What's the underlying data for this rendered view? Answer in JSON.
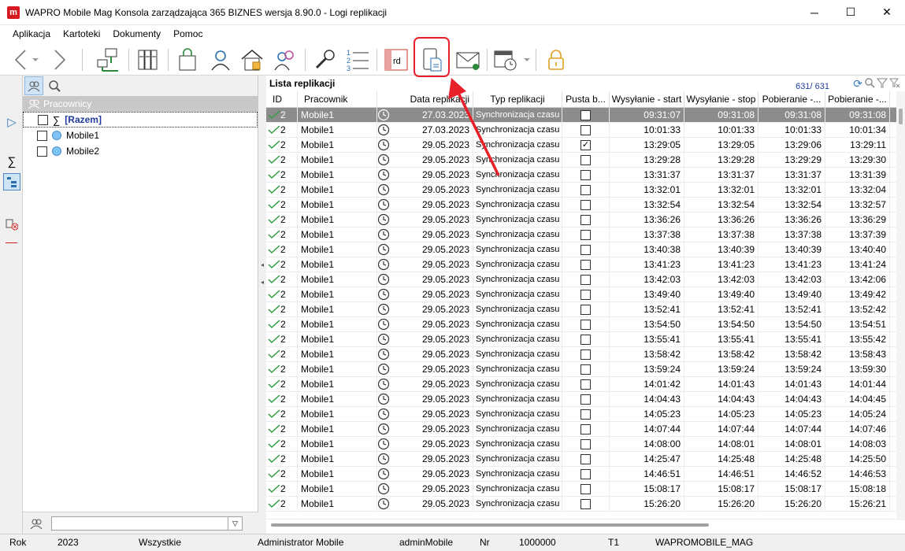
{
  "window": {
    "title": "WAPRO Mobile Mag Konsola zarządzająca 365 BIZNES wersja 8.90.0 - Logi replikacji",
    "logo_letter": "m",
    "minimize": "─",
    "maximize": "☐",
    "close": "✕"
  },
  "menu": [
    "Aplikacja",
    "Kartoteki",
    "Dokumenty",
    "Pomoc"
  ],
  "toolbar": {
    "rd_label": "rd",
    "icons": [
      "back-arrow-icon",
      "forward-arrow-icon",
      "network-icon",
      "binders-icon",
      "shopping-bag-icon",
      "user-icon",
      "home-icon",
      "users-icon",
      "wrench-icon",
      "numbered-list-icon",
      "rd-report-icon",
      "mobile-document-icon",
      "envelope-icon",
      "calendar-clock-icon",
      "lock-icon"
    ]
  },
  "left_panel": {
    "header": "Pracownicy",
    "items": [
      {
        "label": "[Razem]",
        "type": "sum"
      },
      {
        "label": "Mobile1",
        "type": "user"
      },
      {
        "label": "Mobile2",
        "type": "user"
      }
    ],
    "filter_value": ""
  },
  "list": {
    "title": "Lista replikacji",
    "counter": "631/ 631",
    "columns": [
      "ID",
      "Pracownik",
      "Data replikacji",
      "Typ replikacji",
      "Pusta b...",
      "Wysyłanie - start",
      "Wysyłanie - stop",
      "Pobieranie -...",
      "Pobieranie -..."
    ],
    "rows": [
      {
        "id": "2",
        "p": "Mobile1",
        "d": "27.03.2023",
        "t": "Synchronizacja czasu",
        "b": false,
        "ws": "09:31:07",
        "we": "09:31:08",
        "ps": "09:31:08",
        "pe": "09:31:08"
      },
      {
        "id": "2",
        "p": "Mobile1",
        "d": "27.03.2023",
        "t": "Synchronizacja czasu",
        "b": false,
        "ws": "10:01:33",
        "we": "10:01:33",
        "ps": "10:01:33",
        "pe": "10:01:34"
      },
      {
        "id": "2",
        "p": "Mobile1",
        "d": "29.05.2023",
        "t": "Synchronizacja czasu",
        "b": true,
        "ws": "13:29:05",
        "we": "13:29:05",
        "ps": "13:29:06",
        "pe": "13:29:11"
      },
      {
        "id": "2",
        "p": "Mobile1",
        "d": "29.05.2023",
        "t": "Synchronizacja czasu",
        "b": false,
        "ws": "13:29:28",
        "we": "13:29:28",
        "ps": "13:29:29",
        "pe": "13:29:30"
      },
      {
        "id": "2",
        "p": "Mobile1",
        "d": "29.05.2023",
        "t": "Synchronizacja czasu",
        "b": false,
        "ws": "13:31:37",
        "we": "13:31:37",
        "ps": "13:31:37",
        "pe": "13:31:39"
      },
      {
        "id": "2",
        "p": "Mobile1",
        "d": "29.05.2023",
        "t": "Synchronizacja czasu",
        "b": false,
        "ws": "13:32:01",
        "we": "13:32:01",
        "ps": "13:32:01",
        "pe": "13:32:04"
      },
      {
        "id": "2",
        "p": "Mobile1",
        "d": "29.05.2023",
        "t": "Synchronizacja czasu",
        "b": false,
        "ws": "13:32:54",
        "we": "13:32:54",
        "ps": "13:32:54",
        "pe": "13:32:57"
      },
      {
        "id": "2",
        "p": "Mobile1",
        "d": "29.05.2023",
        "t": "Synchronizacja czasu",
        "b": false,
        "ws": "13:36:26",
        "we": "13:36:26",
        "ps": "13:36:26",
        "pe": "13:36:29"
      },
      {
        "id": "2",
        "p": "Mobile1",
        "d": "29.05.2023",
        "t": "Synchronizacja czasu",
        "b": false,
        "ws": "13:37:38",
        "we": "13:37:38",
        "ps": "13:37:38",
        "pe": "13:37:39"
      },
      {
        "id": "2",
        "p": "Mobile1",
        "d": "29.05.2023",
        "t": "Synchronizacja czasu",
        "b": false,
        "ws": "13:40:38",
        "we": "13:40:39",
        "ps": "13:40:39",
        "pe": "13:40:40"
      },
      {
        "id": "2",
        "p": "Mobile1",
        "d": "29.05.2023",
        "t": "Synchronizacja czasu",
        "b": false,
        "ws": "13:41:23",
        "we": "13:41:23",
        "ps": "13:41:23",
        "pe": "13:41:24"
      },
      {
        "id": "2",
        "p": "Mobile1",
        "d": "29.05.2023",
        "t": "Synchronizacja czasu",
        "b": false,
        "ws": "13:42:03",
        "we": "13:42:03",
        "ps": "13:42:03",
        "pe": "13:42:06"
      },
      {
        "id": "2",
        "p": "Mobile1",
        "d": "29.05.2023",
        "t": "Synchronizacja czasu",
        "b": false,
        "ws": "13:49:40",
        "we": "13:49:40",
        "ps": "13:49:40",
        "pe": "13:49:42"
      },
      {
        "id": "2",
        "p": "Mobile1",
        "d": "29.05.2023",
        "t": "Synchronizacja czasu",
        "b": false,
        "ws": "13:52:41",
        "we": "13:52:41",
        "ps": "13:52:41",
        "pe": "13:52:42"
      },
      {
        "id": "2",
        "p": "Mobile1",
        "d": "29.05.2023",
        "t": "Synchronizacja czasu",
        "b": false,
        "ws": "13:54:50",
        "we": "13:54:50",
        "ps": "13:54:50",
        "pe": "13:54:51"
      },
      {
        "id": "2",
        "p": "Mobile1",
        "d": "29.05.2023",
        "t": "Synchronizacja czasu",
        "b": false,
        "ws": "13:55:41",
        "we": "13:55:41",
        "ps": "13:55:41",
        "pe": "13:55:42"
      },
      {
        "id": "2",
        "p": "Mobile1",
        "d": "29.05.2023",
        "t": "Synchronizacja czasu",
        "b": false,
        "ws": "13:58:42",
        "we": "13:58:42",
        "ps": "13:58:42",
        "pe": "13:58:43"
      },
      {
        "id": "2",
        "p": "Mobile1",
        "d": "29.05.2023",
        "t": "Synchronizacja czasu",
        "b": false,
        "ws": "13:59:24",
        "we": "13:59:24",
        "ps": "13:59:24",
        "pe": "13:59:30"
      },
      {
        "id": "2",
        "p": "Mobile1",
        "d": "29.05.2023",
        "t": "Synchronizacja czasu",
        "b": false,
        "ws": "14:01:42",
        "we": "14:01:43",
        "ps": "14:01:43",
        "pe": "14:01:44"
      },
      {
        "id": "2",
        "p": "Mobile1",
        "d": "29.05.2023",
        "t": "Synchronizacja czasu",
        "b": false,
        "ws": "14:04:43",
        "we": "14:04:43",
        "ps": "14:04:43",
        "pe": "14:04:45"
      },
      {
        "id": "2",
        "p": "Mobile1",
        "d": "29.05.2023",
        "t": "Synchronizacja czasu",
        "b": false,
        "ws": "14:05:23",
        "we": "14:05:23",
        "ps": "14:05:23",
        "pe": "14:05:24"
      },
      {
        "id": "2",
        "p": "Mobile1",
        "d": "29.05.2023",
        "t": "Synchronizacja czasu",
        "b": false,
        "ws": "14:07:44",
        "we": "14:07:44",
        "ps": "14:07:44",
        "pe": "14:07:46"
      },
      {
        "id": "2",
        "p": "Mobile1",
        "d": "29.05.2023",
        "t": "Synchronizacja czasu",
        "b": false,
        "ws": "14:08:00",
        "we": "14:08:01",
        "ps": "14:08:01",
        "pe": "14:08:03"
      },
      {
        "id": "2",
        "p": "Mobile1",
        "d": "29.05.2023",
        "t": "Synchronizacja czasu",
        "b": false,
        "ws": "14:25:47",
        "we": "14:25:48",
        "ps": "14:25:48",
        "pe": "14:25:50"
      },
      {
        "id": "2",
        "p": "Mobile1",
        "d": "29.05.2023",
        "t": "Synchronizacja czasu",
        "b": false,
        "ws": "14:46:51",
        "we": "14:46:51",
        "ps": "14:46:52",
        "pe": "14:46:53"
      },
      {
        "id": "2",
        "p": "Mobile1",
        "d": "29.05.2023",
        "t": "Synchronizacja czasu",
        "b": false,
        "ws": "15:08:17",
        "we": "15:08:17",
        "ps": "15:08:17",
        "pe": "15:08:18"
      },
      {
        "id": "2",
        "p": "Mobile1",
        "d": "29.05.2023",
        "t": "Synchronizacja czasu",
        "b": false,
        "ws": "15:26:20",
        "we": "15:26:20",
        "ps": "15:26:20",
        "pe": "15:26:21"
      }
    ]
  },
  "status": {
    "rok_label": "Rok",
    "rok_value": "2023",
    "filter": "Wszystkie",
    "user": "Administrator Mobile",
    "login": "adminMobile",
    "nr_label": "Nr",
    "nr_value": "1000000",
    "t": "T1",
    "db": "WAPROMOBILE_MAG"
  },
  "colors": {
    "accent_red": "#e8202a",
    "selection_gray": "#8c8c8c",
    "check_green": "#2e9e3e"
  }
}
